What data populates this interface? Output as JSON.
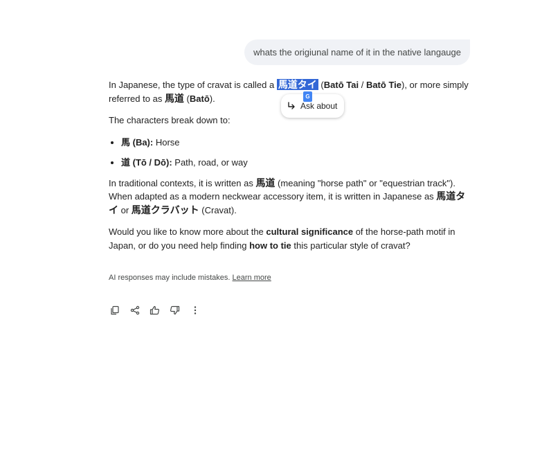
{
  "user_message": "whats the origiunal name of it in the native langauge",
  "response": {
    "p1": {
      "t1": "In Japanese, the type of cravat is called a ",
      "highlight": "馬道タイ",
      "t2": " (",
      "b1": "Batō Tai",
      "t3": " / ",
      "b2": "Batō Tie",
      "t4": "), or more simply referred to as ",
      "b3": "馬道",
      "t5": " (",
      "b4": "Batō",
      "t6": ")."
    },
    "p2": "The characters break down to:",
    "list": [
      {
        "term": "馬 (Ba):",
        "desc": " Horse"
      },
      {
        "term": "道 (Tō / Dō):",
        "desc": " Path, road, or way"
      }
    ],
    "p3": {
      "t1": "In traditional contexts, it is written as ",
      "b1": "馬道",
      "t2": " (meaning \"horse path\" or \"equestrian track\"). When adapted as a modern neckwear accessory item, it is written in Japanese as ",
      "b2": "馬道タイ",
      "t3": " or ",
      "b3": "馬道クラバット",
      "t4": " (Cravat)."
    },
    "p4": {
      "t1": "Would you like to know more about the ",
      "b1": "cultural significance",
      "t2": " of the horse-path motif in Japan, or do you need help finding ",
      "b2": "how to tie",
      "t3": " this particular style of cravat?"
    }
  },
  "popup": {
    "label": "Ask about",
    "badge": "G"
  },
  "disclaimer": {
    "text": "AI responses may include mistakes. ",
    "link": "Learn more"
  },
  "actions": {
    "icons": [
      "copy-icon",
      "share-icon",
      "thumbs-up-icon",
      "thumbs-down-icon",
      "more-vert-icon"
    ]
  },
  "colors": {
    "selection": "#3367d6",
    "bubble": "#f0f2f6",
    "text": "#1f1f1f",
    "muted": "#444746"
  }
}
